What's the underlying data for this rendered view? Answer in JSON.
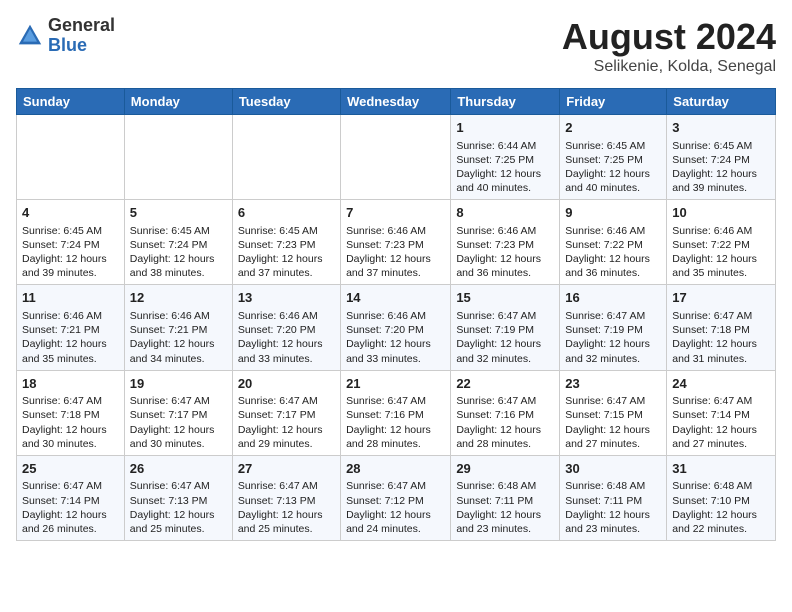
{
  "logo": {
    "general": "General",
    "blue": "Blue"
  },
  "title": "August 2024",
  "location": "Selikenie, Kolda, Senegal",
  "days_header": [
    "Sunday",
    "Monday",
    "Tuesday",
    "Wednesday",
    "Thursday",
    "Friday",
    "Saturday"
  ],
  "weeks": [
    [
      {
        "day": "",
        "content": ""
      },
      {
        "day": "",
        "content": ""
      },
      {
        "day": "",
        "content": ""
      },
      {
        "day": "",
        "content": ""
      },
      {
        "day": "1",
        "content": "Sunrise: 6:44 AM\nSunset: 7:25 PM\nDaylight: 12 hours\nand 40 minutes."
      },
      {
        "day": "2",
        "content": "Sunrise: 6:45 AM\nSunset: 7:25 PM\nDaylight: 12 hours\nand 40 minutes."
      },
      {
        "day": "3",
        "content": "Sunrise: 6:45 AM\nSunset: 7:24 PM\nDaylight: 12 hours\nand 39 minutes."
      }
    ],
    [
      {
        "day": "4",
        "content": "Sunrise: 6:45 AM\nSunset: 7:24 PM\nDaylight: 12 hours\nand 39 minutes."
      },
      {
        "day": "5",
        "content": "Sunrise: 6:45 AM\nSunset: 7:24 PM\nDaylight: 12 hours\nand 38 minutes."
      },
      {
        "day": "6",
        "content": "Sunrise: 6:45 AM\nSunset: 7:23 PM\nDaylight: 12 hours\nand 37 minutes."
      },
      {
        "day": "7",
        "content": "Sunrise: 6:46 AM\nSunset: 7:23 PM\nDaylight: 12 hours\nand 37 minutes."
      },
      {
        "day": "8",
        "content": "Sunrise: 6:46 AM\nSunset: 7:23 PM\nDaylight: 12 hours\nand 36 minutes."
      },
      {
        "day": "9",
        "content": "Sunrise: 6:46 AM\nSunset: 7:22 PM\nDaylight: 12 hours\nand 36 minutes."
      },
      {
        "day": "10",
        "content": "Sunrise: 6:46 AM\nSunset: 7:22 PM\nDaylight: 12 hours\nand 35 minutes."
      }
    ],
    [
      {
        "day": "11",
        "content": "Sunrise: 6:46 AM\nSunset: 7:21 PM\nDaylight: 12 hours\nand 35 minutes."
      },
      {
        "day": "12",
        "content": "Sunrise: 6:46 AM\nSunset: 7:21 PM\nDaylight: 12 hours\nand 34 minutes."
      },
      {
        "day": "13",
        "content": "Sunrise: 6:46 AM\nSunset: 7:20 PM\nDaylight: 12 hours\nand 33 minutes."
      },
      {
        "day": "14",
        "content": "Sunrise: 6:46 AM\nSunset: 7:20 PM\nDaylight: 12 hours\nand 33 minutes."
      },
      {
        "day": "15",
        "content": "Sunrise: 6:47 AM\nSunset: 7:19 PM\nDaylight: 12 hours\nand 32 minutes."
      },
      {
        "day": "16",
        "content": "Sunrise: 6:47 AM\nSunset: 7:19 PM\nDaylight: 12 hours\nand 32 minutes."
      },
      {
        "day": "17",
        "content": "Sunrise: 6:47 AM\nSunset: 7:18 PM\nDaylight: 12 hours\nand 31 minutes."
      }
    ],
    [
      {
        "day": "18",
        "content": "Sunrise: 6:47 AM\nSunset: 7:18 PM\nDaylight: 12 hours\nand 30 minutes."
      },
      {
        "day": "19",
        "content": "Sunrise: 6:47 AM\nSunset: 7:17 PM\nDaylight: 12 hours\nand 30 minutes."
      },
      {
        "day": "20",
        "content": "Sunrise: 6:47 AM\nSunset: 7:17 PM\nDaylight: 12 hours\nand 29 minutes."
      },
      {
        "day": "21",
        "content": "Sunrise: 6:47 AM\nSunset: 7:16 PM\nDaylight: 12 hours\nand 28 minutes."
      },
      {
        "day": "22",
        "content": "Sunrise: 6:47 AM\nSunset: 7:16 PM\nDaylight: 12 hours\nand 28 minutes."
      },
      {
        "day": "23",
        "content": "Sunrise: 6:47 AM\nSunset: 7:15 PM\nDaylight: 12 hours\nand 27 minutes."
      },
      {
        "day": "24",
        "content": "Sunrise: 6:47 AM\nSunset: 7:14 PM\nDaylight: 12 hours\nand 27 minutes."
      }
    ],
    [
      {
        "day": "25",
        "content": "Sunrise: 6:47 AM\nSunset: 7:14 PM\nDaylight: 12 hours\nand 26 minutes."
      },
      {
        "day": "26",
        "content": "Sunrise: 6:47 AM\nSunset: 7:13 PM\nDaylight: 12 hours\nand 25 minutes."
      },
      {
        "day": "27",
        "content": "Sunrise: 6:47 AM\nSunset: 7:13 PM\nDaylight: 12 hours\nand 25 minutes."
      },
      {
        "day": "28",
        "content": "Sunrise: 6:47 AM\nSunset: 7:12 PM\nDaylight: 12 hours\nand 24 minutes."
      },
      {
        "day": "29",
        "content": "Sunrise: 6:48 AM\nSunset: 7:11 PM\nDaylight: 12 hours\nand 23 minutes."
      },
      {
        "day": "30",
        "content": "Sunrise: 6:48 AM\nSunset: 7:11 PM\nDaylight: 12 hours\nand 23 minutes."
      },
      {
        "day": "31",
        "content": "Sunrise: 6:48 AM\nSunset: 7:10 PM\nDaylight: 12 hours\nand 22 minutes."
      }
    ]
  ]
}
